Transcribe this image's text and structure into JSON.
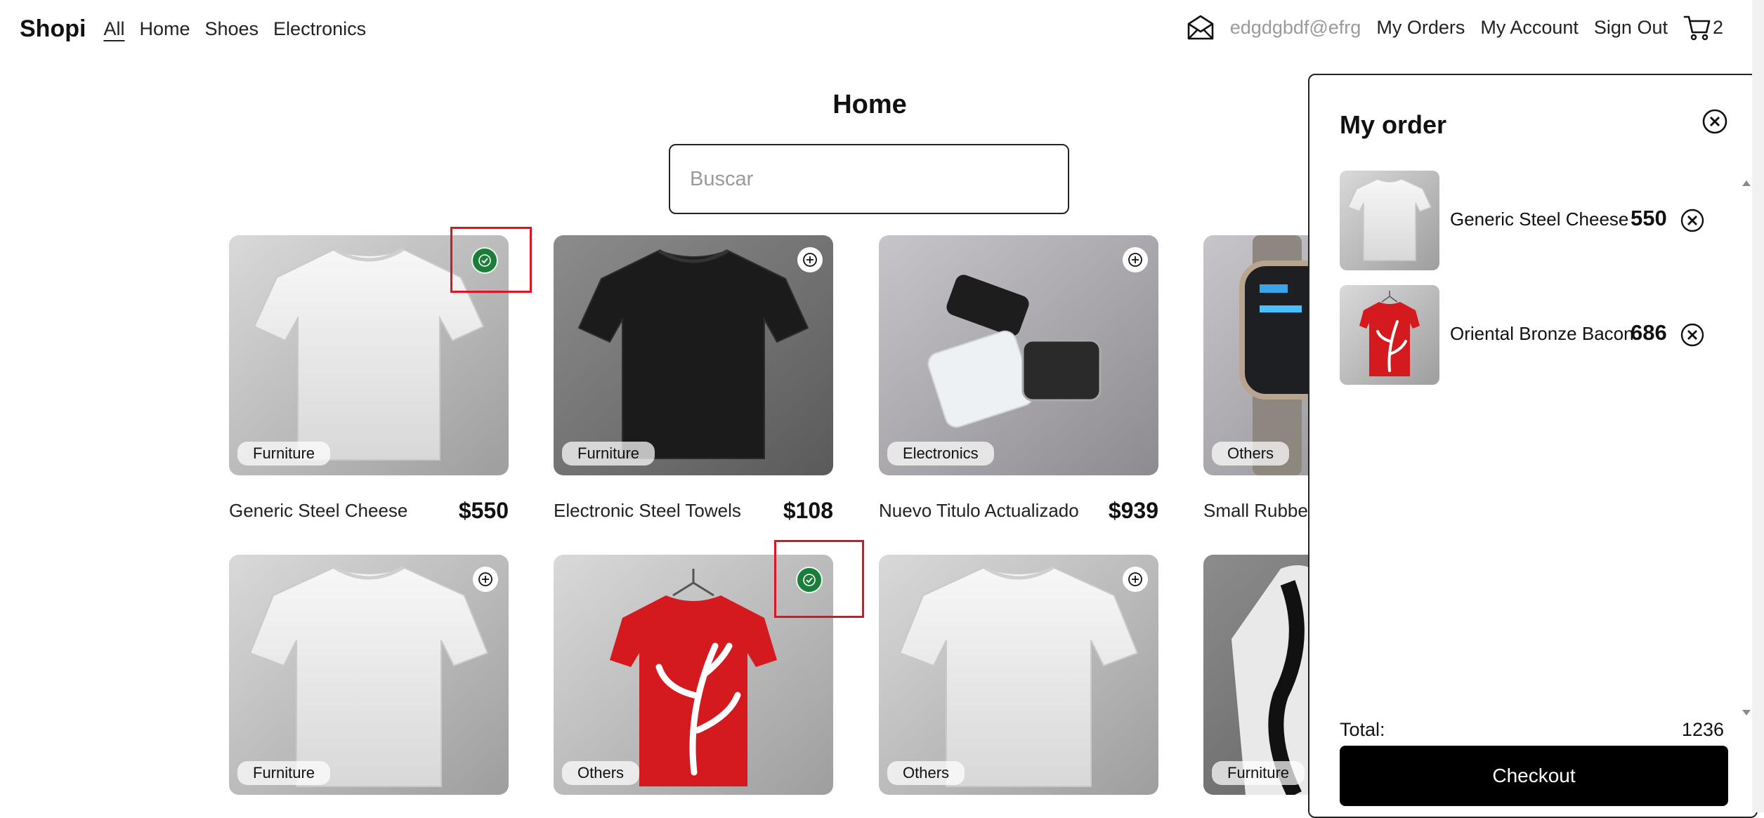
{
  "nav": {
    "brand": "Shopi",
    "links": [
      "All",
      "Home",
      "Shoes",
      "Electronics"
    ],
    "email": "edgdgbdf@efrg",
    "my_orders": "My Orders",
    "my_account": "My Account",
    "sign_out": "Sign Out",
    "cart_count": "2"
  },
  "main": {
    "title": "Home",
    "search_placeholder": "Buscar"
  },
  "products": [
    {
      "name": "Generic Steel Cheese",
      "price": "$550",
      "category": "Furniture",
      "in_cart": true
    },
    {
      "name": "Electronic Steel Towels",
      "price": "$108",
      "category": "Furniture",
      "in_cart": false
    },
    {
      "name": "Nuevo Titulo Actualizado",
      "price": "$939",
      "category": "Electronics",
      "in_cart": false
    },
    {
      "name": "Small Rubber",
      "price": "",
      "category": "Others",
      "in_cart": false
    },
    {
      "name": "",
      "price": "",
      "category": "Furniture",
      "in_cart": false
    },
    {
      "name": "",
      "price": "",
      "category": "Others",
      "in_cart": true
    },
    {
      "name": "",
      "price": "",
      "category": "Others",
      "in_cart": false
    },
    {
      "name": "",
      "price": "",
      "category": "Furniture",
      "in_cart": false
    }
  ],
  "order": {
    "title": "My order",
    "items": [
      {
        "name": "Generic Steel Cheese",
        "price": "550"
      },
      {
        "name": "Oriental Bronze Bacon",
        "price": "686"
      }
    ],
    "total_label": "Total:",
    "total_value": "1236",
    "checkout_label": "Checkout"
  },
  "icons": {
    "mail": "envelope-open-icon",
    "cart": "shopping-cart-icon",
    "add": "plus-circle-icon",
    "check": "check-circle-icon",
    "close": "x-circle-icon"
  },
  "colors": {
    "in_cart_green": "#1b7d3a",
    "highlight_red": "#e0141e",
    "checkout_bg": "#000000"
  }
}
